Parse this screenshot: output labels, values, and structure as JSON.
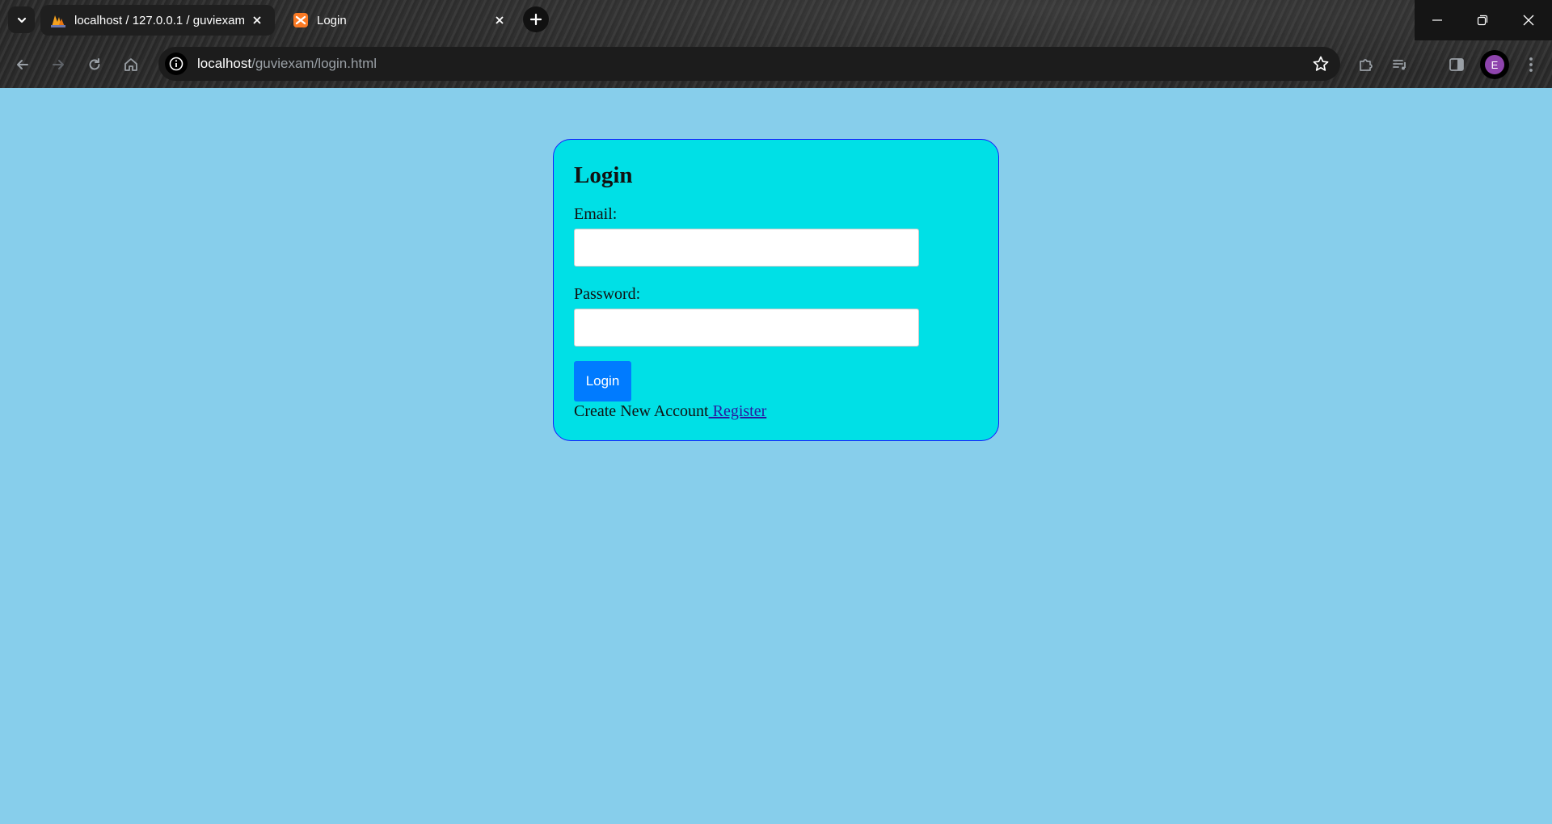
{
  "browser": {
    "tabs": [
      {
        "title": "localhost / 127.0.0.1 / guviexam",
        "favicon": "phpmyadmin-icon",
        "active": true
      },
      {
        "title": "Login",
        "favicon": "xampp-icon",
        "active": false
      }
    ],
    "address": {
      "host": "localhost",
      "path": "/guviexam/login.html"
    },
    "profile_initial": "E",
    "colors": {
      "profile": "#8e44ad"
    }
  },
  "page": {
    "background": "#87ceeb",
    "card_color": "#00e0e6",
    "title": "Login",
    "email_label": "Email:",
    "email_value": "",
    "password_label": "Password:",
    "password_value": "",
    "login_button": "Login",
    "footer_text": "Create New Account",
    "register_link": " Register",
    "button_color": "#007bff"
  }
}
